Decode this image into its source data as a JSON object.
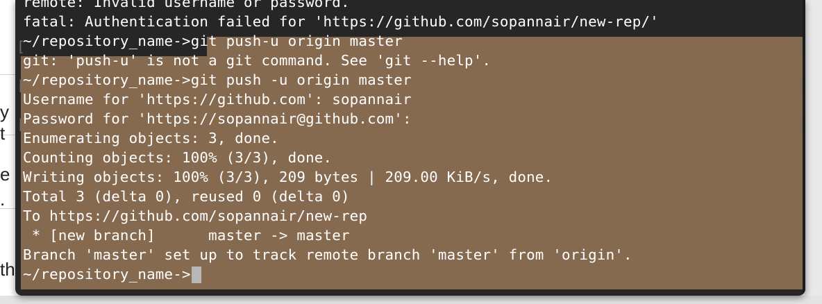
{
  "background": {
    "fragments": [
      "y t",
      "e",
      ".",
      "th"
    ]
  },
  "terminal": {
    "lines": [
      {
        "text": "remote: Invalid username or password."
      },
      {
        "text": "fatal: Authentication failed for 'https://github.com/sopannair/new-rep/'"
      },
      {
        "text": "~/repository_name->git push-u origin master"
      },
      {
        "text": "git: 'push-u' is not a git command. See 'git --help'."
      },
      {
        "text": "~/repository_name->git push -u origin master"
      },
      {
        "text": "Username for 'https://github.com': sopannair"
      },
      {
        "text": "Password for 'https://sopannair@github.com':"
      },
      {
        "text": "Enumerating objects: 3, done."
      },
      {
        "text": "Counting objects: 100% (3/3), done."
      },
      {
        "text": "Writing objects: 100% (3/3), 209 bytes | 209.00 KiB/s, done."
      },
      {
        "text": "Total 3 (delta 0), reused 0 (delta 0)"
      },
      {
        "text": "To https://github.com/sopannair/new-rep"
      },
      {
        "text": " * [new branch]      master -> master"
      },
      {
        "text": "Branch 'master' set up to track remote branch 'master' from 'origin'."
      },
      {
        "text": "~/repository_name->"
      }
    ],
    "colors": {
      "background": "#262626",
      "selection": "#866a4f",
      "text": "#ffffff",
      "cursor": "#b8b8b8"
    }
  }
}
